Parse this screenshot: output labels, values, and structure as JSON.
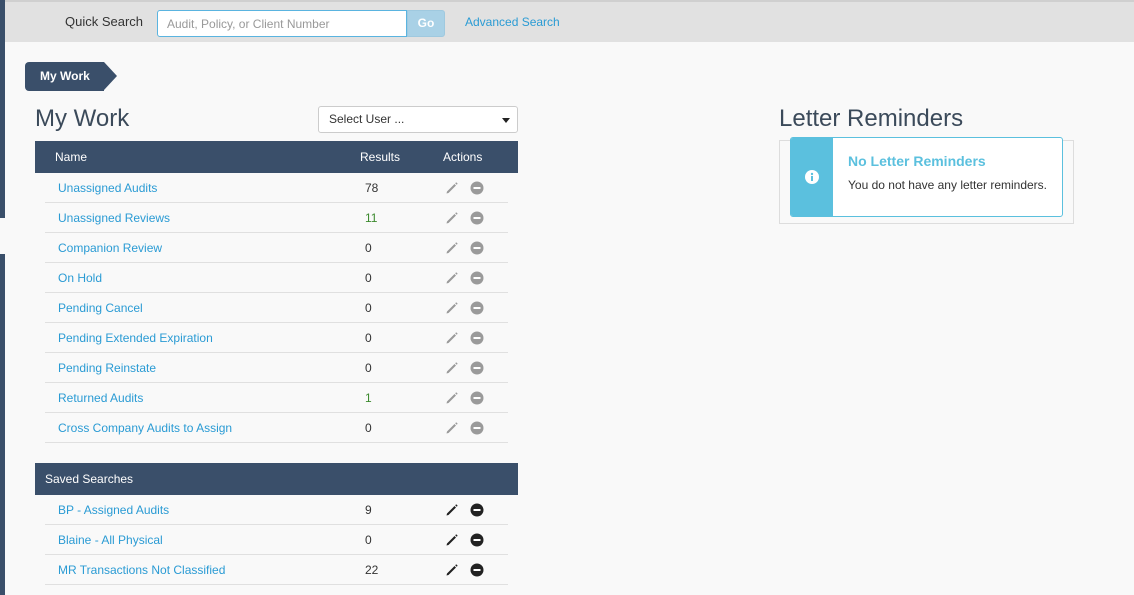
{
  "search": {
    "label": "Quick Search",
    "placeholder": "Audit, Policy, or Client Number",
    "go_label": "Go",
    "advanced_label": "Advanced Search"
  },
  "breadcrumb": {
    "item": "My Work"
  },
  "my_work": {
    "title": "My Work",
    "user_select": "Select User ...",
    "headers": {
      "name": "Name",
      "results": "Results",
      "actions": "Actions"
    },
    "rows": [
      {
        "name": "Unassigned Audits",
        "results": "78"
      },
      {
        "name": "Unassigned Reviews",
        "results": "11"
      },
      {
        "name": "Companion Review",
        "results": "0"
      },
      {
        "name": "On Hold",
        "results": "0"
      },
      {
        "name": "Pending Cancel",
        "results": "0"
      },
      {
        "name": "Pending Extended Expiration",
        "results": "0"
      },
      {
        "name": "Pending Reinstate",
        "results": "0"
      },
      {
        "name": "Returned Audits",
        "results": "1"
      },
      {
        "name": "Cross Company Audits to Assign",
        "results": "0"
      }
    ]
  },
  "saved_searches": {
    "title": "Saved Searches",
    "rows": [
      {
        "name": "BP - Assigned Audits",
        "results": "9"
      },
      {
        "name": "Blaine - All Physical",
        "results": "0"
      },
      {
        "name": "MR Transactions Not Classified",
        "results": "22"
      }
    ]
  },
  "letter_reminders": {
    "title": "Letter Reminders",
    "alert_title": "No Letter Reminders",
    "alert_message": "You do not have any letter reminders."
  },
  "colors": {
    "navy": "#3a4f6a",
    "link": "#2a9bd4",
    "info": "#5bc0de",
    "icon_inactive": "#9a9a9a",
    "icon_active": "#222222"
  },
  "icons": {
    "edit": "pencil-icon",
    "remove": "minus-circle-icon",
    "info": "info-icon"
  }
}
